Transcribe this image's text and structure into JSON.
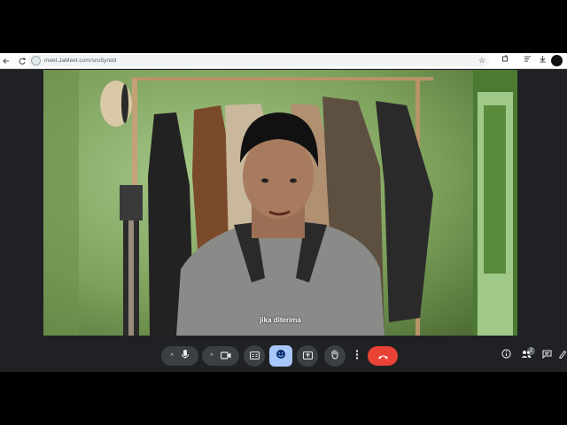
{
  "browser": {
    "url": "meet.JaMeet.com/sns5yndd"
  },
  "video": {
    "subtitle": "jika diterima"
  },
  "controls": {
    "participant_count": "2",
    "hangup_color": "#ea4335",
    "reaction_active_color": "#a8c7fa"
  },
  "icons": {
    "back": "back-icon",
    "reload": "reload-icon",
    "star": "star-icon",
    "extensions": "extensions-icon",
    "download": "download-icon",
    "microphone": "microphone-icon",
    "camera": "camera-icon",
    "captions": "captions-icon",
    "emoji": "emoji-icon",
    "present": "present-icon",
    "hand": "raise-hand-icon",
    "more": "more-options-icon",
    "hangup": "hangup-icon",
    "info": "info-icon",
    "people": "people-icon",
    "chat": "chat-icon",
    "activities": "activities-icon"
  }
}
